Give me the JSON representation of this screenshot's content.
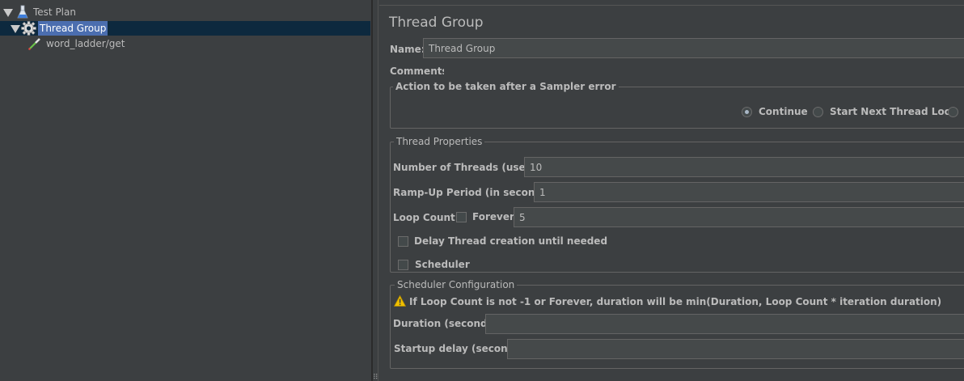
{
  "tree": {
    "items": [
      {
        "label": "Test Plan",
        "icon": "flask-icon"
      },
      {
        "label": "Thread Group",
        "icon": "gear-icon"
      },
      {
        "label": "word_ladder/get",
        "icon": "pipette-icon"
      }
    ]
  },
  "panel": {
    "title": "Thread Group",
    "name_label": "Name:",
    "name_value": "Thread Group",
    "comments_label": "Comments:",
    "comments_value": "",
    "sampler_error": {
      "title": "Action to be taken after a Sampler error",
      "options": [
        {
          "label": "Continue",
          "selected": true
        },
        {
          "label": "Start Next Thread Loop",
          "selected": false
        },
        {
          "label": "",
          "selected": false
        }
      ]
    },
    "thread_props": {
      "title": "Thread Properties",
      "threads_label": "Number of Threads (users):",
      "threads_value": "10",
      "rampup_label": "Ramp-Up Period (in seconds):",
      "rampup_value": "1",
      "loop_label": "Loop Count:",
      "forever_label": "Forever",
      "forever_checked": false,
      "loop_value": "5",
      "delay_label": "Delay Thread creation until needed",
      "delay_checked": false,
      "scheduler_label": "Scheduler",
      "scheduler_checked": false
    },
    "scheduler_config": {
      "title": "Scheduler Configuration",
      "warning": "If Loop Count is not -1 or Forever, duration will be min(Duration, Loop Count * iteration duration)",
      "duration_label": "Duration (seconds)",
      "duration_value": "",
      "startup_label": "Startup delay (seconds)",
      "startup_value": ""
    }
  },
  "colors": {
    "background": "#3c3f41",
    "selection_row": "#0d293e",
    "selection_label": "#4b6eaf",
    "field_bg": "#45494a",
    "text": "#bbbbbb",
    "warning": "#f0c000"
  }
}
